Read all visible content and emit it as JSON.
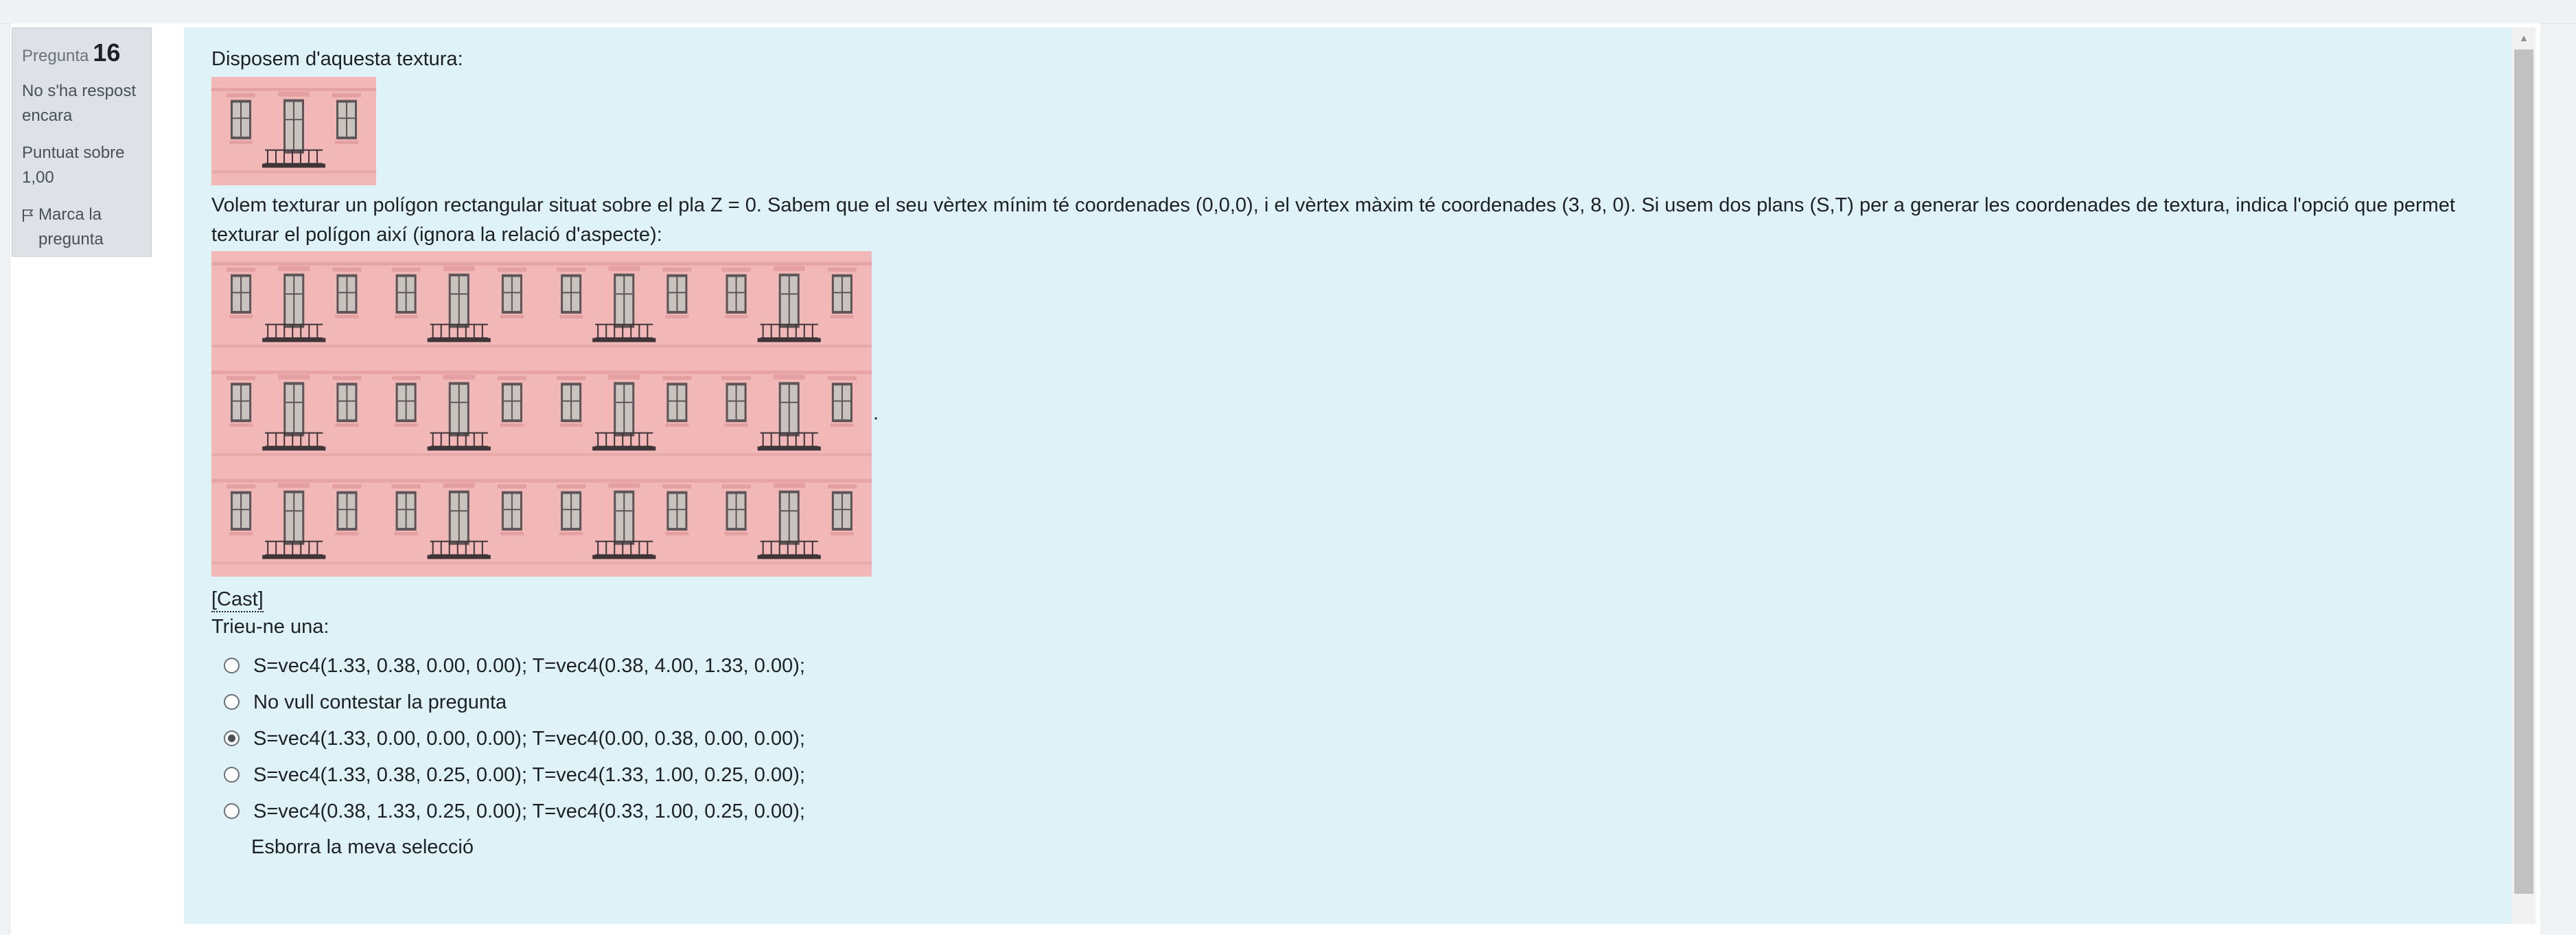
{
  "question_info": {
    "label": "Pregunta",
    "number": "16",
    "status_line1": "No s'ha respost",
    "status_line2": "encara",
    "mark_line1": "Puntuat sobre",
    "mark_line2": "1,00",
    "flag_line1": "Marca la",
    "flag_line2": "pregunta"
  },
  "question": {
    "intro": "Disposem d'aquesta textura:",
    "text": "Volem texturar un polígon rectangular situat sobre el pla Z = 0. Sabem que el seu vèrtex mínim té coordenades (0,0,0), i el vèrtex màxim té coordenades (3, 8, 0). Si usem dos plans (S,T) per a generar les coordenades de textura, indica l'opció que permet texturar el polígon així (ignora la relació d'aspecte):",
    "trailing_dot": ".",
    "cast_link": "[Cast]",
    "prompt": "Trieu-ne una:",
    "answers": [
      "S=vec4(1.33, 0.38, 0.00, 0.00); T=vec4(0.38, 4.00, 1.33, 0.00);",
      "No vull contestar la pregunta",
      "S=vec4(1.33, 0.00, 0.00, 0.00); T=vec4(0.00, 0.38, 0.00, 0.00);",
      "S=vec4(1.33, 0.38, 0.25, 0.00); T=vec4(1.33, 1.00, 0.25, 0.00);",
      "S=vec4(0.38, 1.33, 0.25, 0.00); T=vec4(0.33, 1.00, 0.25, 0.00);"
    ],
    "selected_answer": "S=vec4(1.33, 0.00, 0.00, 0.00); T=vec4(0.00, 0.38, 0.00, 0.00);",
    "clear_label": "Esborra la meva selecció"
  },
  "colors": {
    "content_bg": "#def2f8",
    "info_bg": "#dee2e6",
    "wall": "#f2b7b7",
    "window": "#5d5457"
  },
  "images": {
    "texture_single": "pink building facade texture (1 tile)",
    "texture_tiled": "pink building facade texture tiled 4 x 3"
  }
}
